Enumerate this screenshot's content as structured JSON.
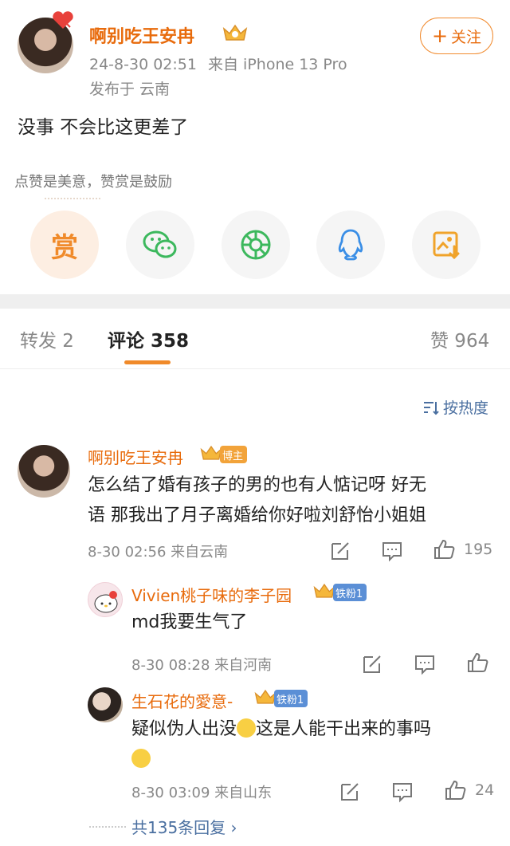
{
  "post": {
    "author": "啊别吃王安冉",
    "timestamp": "24-8-30 02:51",
    "source": "来自 iPhone 13 Pro",
    "location": "发布于 云南",
    "follow_label": "关注",
    "text": "没事 不会比这更差了"
  },
  "reward": {
    "hint": "点赞是美意，赞赏是鼓励",
    "reward_char": "赏"
  },
  "share_icons": [
    "reward-icon",
    "wechat-icon",
    "moments-icon",
    "qq-icon",
    "save-image-icon"
  ],
  "tabs": {
    "repost": "转发 2",
    "comments": "评论 358",
    "likes": "赞 964"
  },
  "sort_label": "按热度",
  "comments": [
    {
      "name": "啊别吃王安冉",
      "badge": "博主",
      "text_line1": "怎么结了婚有孩子的男的也有人惦记呀 好无",
      "text_line2": "语 那我出了月子离婚给你好啦刘舒怡小姐姐",
      "meta": "8-30 02:56  来自云南",
      "likes": "195"
    }
  ],
  "replies": [
    {
      "name": "Vivien桃子味的李子园",
      "badge": "铁粉1",
      "text": "md我要生气了",
      "meta": "8-30 08:28  来自河南",
      "likes": ""
    },
    {
      "name": "生石花的愛意-",
      "badge": "铁粉1",
      "text_a": "疑似伪人出没",
      "text_b": "这是人能干出来的事吗",
      "meta": "8-30 03:09  来自山东",
      "likes": "24"
    }
  ],
  "more_replies": "共135条回复 ›",
  "colors": {
    "accent": "#e86b0c",
    "link": "#4a6fa0",
    "tab_underline": "#f08a2a"
  }
}
